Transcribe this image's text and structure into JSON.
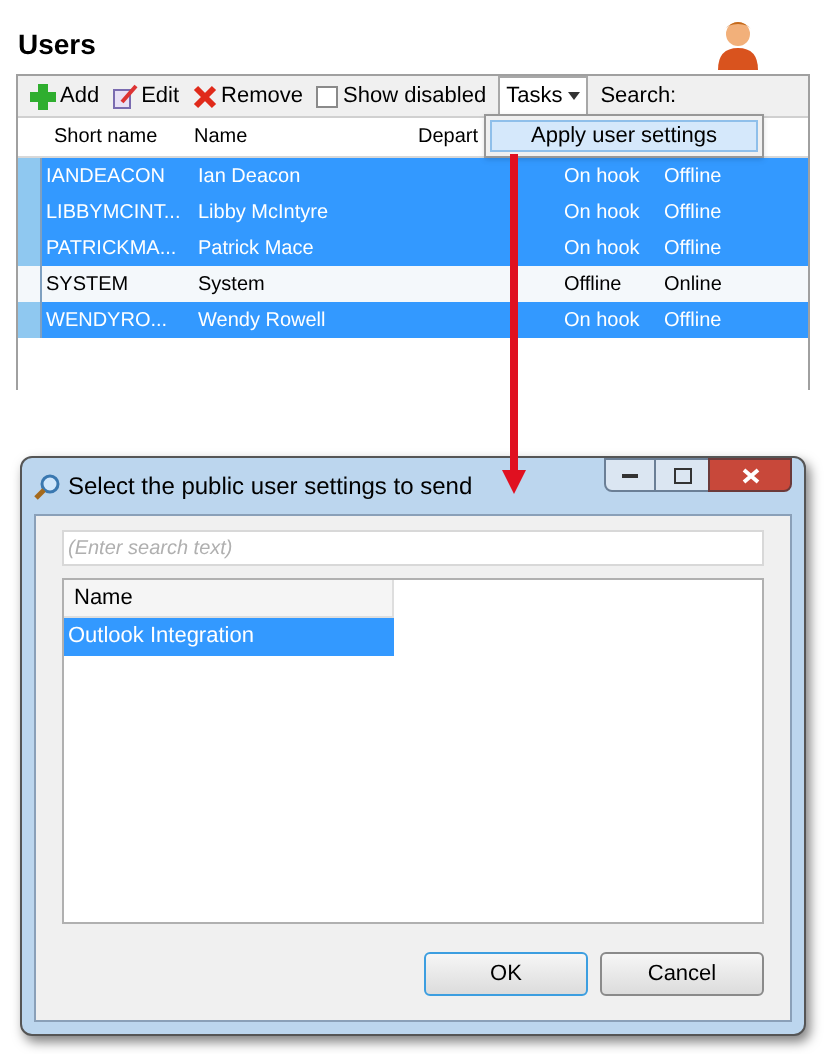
{
  "page": {
    "title": "Users"
  },
  "toolbar": {
    "add": "Add",
    "edit": "Edit",
    "remove": "Remove",
    "show_disabled": {
      "label": "Show disabled",
      "checked": false
    },
    "tasks": "Tasks",
    "search_label": "Search:"
  },
  "tasks_menu": {
    "items": [
      {
        "label": "Apply user settings",
        "selected": true
      }
    ]
  },
  "table": {
    "columns": [
      "Short name",
      "Name",
      "Depart"
    ],
    "rows": [
      {
        "short_name": "IANDEACON",
        "name": "Ian Deacon",
        "column_4": "On hook",
        "column_5": "Offline",
        "selected": true
      },
      {
        "short_name": "LIBBYMCINT...",
        "name": "Libby McIntyre",
        "column_4": "On hook",
        "column_5": "Offline",
        "selected": true
      },
      {
        "short_name": "PATRICKMA...",
        "name": "Patrick Mace",
        "column_4": "On hook",
        "column_5": "Offline",
        "selected": true
      },
      {
        "short_name": "SYSTEM",
        "name": "System",
        "column_4": "Offline",
        "column_5": "Online",
        "selected": false
      },
      {
        "short_name": "WENDYRO...",
        "name": "Wendy Rowell",
        "column_4": "On hook",
        "column_5": "Offline",
        "selected": true
      }
    ]
  },
  "dialog": {
    "title": "Select the public user settings to send",
    "search": {
      "placeholder": "(Enter search text)"
    },
    "list_column": "Name",
    "items": [
      {
        "label": "Outlook Integration",
        "selected": true
      }
    ],
    "buttons": [
      "OK",
      "Cancel"
    ]
  }
}
